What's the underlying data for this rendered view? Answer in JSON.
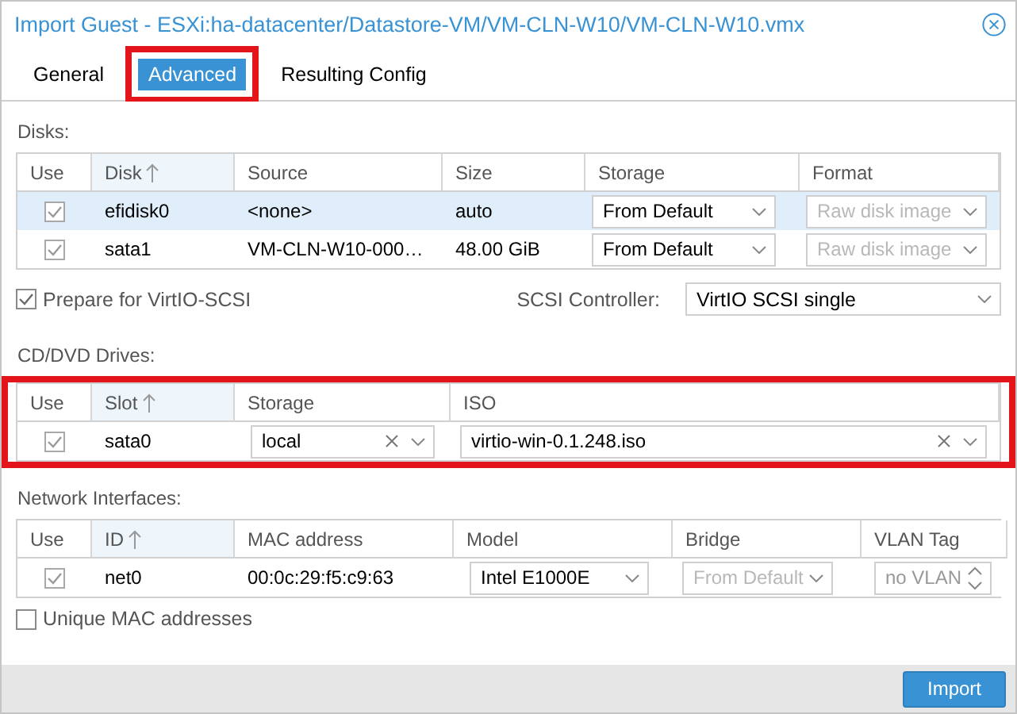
{
  "window": {
    "title": "Import Guest - ESXi:ha-datacenter/Datastore-VM/VM-CLN-W10/VM-CLN-W10.vmx"
  },
  "tabs": [
    {
      "label": "General",
      "selected": false,
      "highlighted": false
    },
    {
      "label": "Advanced",
      "selected": true,
      "highlighted": true
    },
    {
      "label": "Resulting Config",
      "selected": false,
      "highlighted": false
    }
  ],
  "disks": {
    "label": "Disks:",
    "columns": [
      {
        "label": "Use",
        "sorted": false
      },
      {
        "label": "Disk",
        "sorted": true
      },
      {
        "label": "Source",
        "sorted": false
      },
      {
        "label": "Size",
        "sorted": false
      },
      {
        "label": "Storage",
        "sorted": false
      },
      {
        "label": "Format",
        "sorted": false
      }
    ],
    "rows": [
      {
        "use": true,
        "disk": "efidisk0",
        "source": "<none>",
        "size": "auto",
        "storage": "From Default",
        "format": "Raw disk image",
        "format_disabled": true,
        "selected": true
      },
      {
        "use": true,
        "disk": "sata1",
        "source": "VM-CLN-W10-000…",
        "size": "48.00 GiB",
        "storage": "From Default",
        "format": "Raw disk image",
        "format_disabled": true,
        "selected": false
      }
    ]
  },
  "prepare_virtio": {
    "label": "Prepare for VirtIO-SCSI",
    "checked": true
  },
  "scsi_controller": {
    "label": "SCSI Controller:",
    "value": "VirtIO SCSI single"
  },
  "cd_dvd": {
    "label": "CD/DVD Drives:",
    "highlighted": true,
    "columns": [
      {
        "label": "Use",
        "sorted": false
      },
      {
        "label": "Slot",
        "sorted": true
      },
      {
        "label": "Storage",
        "sorted": false
      },
      {
        "label": "ISO",
        "sorted": false
      }
    ],
    "rows": [
      {
        "use": true,
        "slot": "sata0",
        "storage": "local",
        "iso": "virtio-win-0.1.248.iso"
      }
    ]
  },
  "network": {
    "label": "Network Interfaces:",
    "columns": [
      {
        "label": "Use",
        "sorted": false
      },
      {
        "label": "ID",
        "sorted": true
      },
      {
        "label": "MAC address",
        "sorted": false
      },
      {
        "label": "Model",
        "sorted": false
      },
      {
        "label": "Bridge",
        "sorted": false
      },
      {
        "label": "VLAN Tag",
        "sorted": false
      }
    ],
    "rows": [
      {
        "use": true,
        "id": "net0",
        "mac": "00:0c:29:f5:c9:63",
        "model": "Intel E1000E",
        "bridge": "From Default",
        "bridge_disabled": true,
        "vlan_placeholder": "no VLAN"
      }
    ]
  },
  "unique_mac": {
    "label": "Unique MAC addresses",
    "checked": false
  },
  "buttons": [
    "Import"
  ]
}
